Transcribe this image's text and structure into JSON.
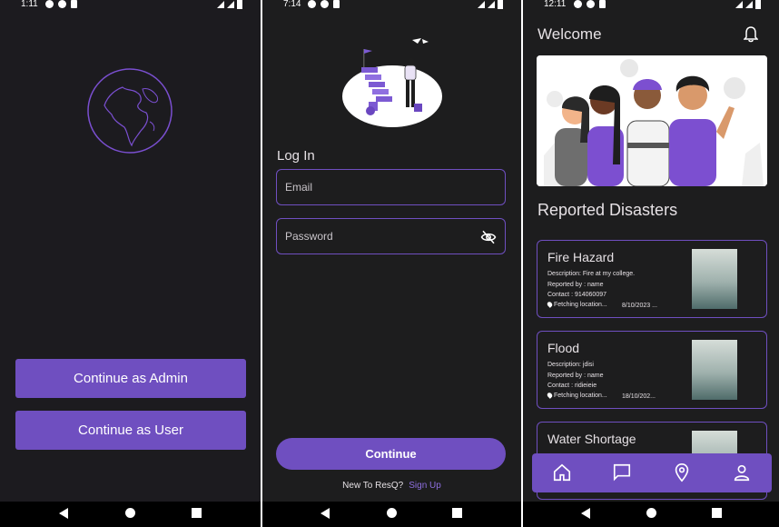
{
  "screens": {
    "start": {
      "status_time": "1:11",
      "admin_button": "Continue as Admin",
      "user_button": "Continue as User",
      "globe_icon": "globe-icon"
    },
    "login": {
      "status_time": "7:14",
      "title": "Log In",
      "email_placeholder": "Email",
      "password_placeholder": "Password",
      "continue_label": "Continue",
      "new_prompt": "New To ResQ?",
      "signup_link": "Sign Up"
    },
    "home": {
      "status_time": "12:11",
      "welcome": "Welcome",
      "section_title": "Reported Disasters",
      "cards": [
        {
          "title": "Fire Hazard",
          "description": "Description: Fire at my college.",
          "reported_by": "Reported by : name",
          "contact": "Contact : 914060097",
          "location": "Fetching location...",
          "date": "8/10/2023 ..."
        },
        {
          "title": "Flood",
          "description": "Description: jdisi",
          "reported_by": "Reported by : name",
          "contact": "Contact : ridieieie",
          "location": "Fetching location...",
          "date": "18/10/202..."
        },
        {
          "title": "Water Shortage"
        }
      ],
      "nav_items": [
        "home-icon",
        "chat-icon",
        "location-icon",
        "profile-icon"
      ]
    }
  },
  "colors": {
    "accent": "#6f4fc0",
    "background": "#1d1d1e",
    "link": "#8e6fe0",
    "text": "#e6e1e5"
  }
}
